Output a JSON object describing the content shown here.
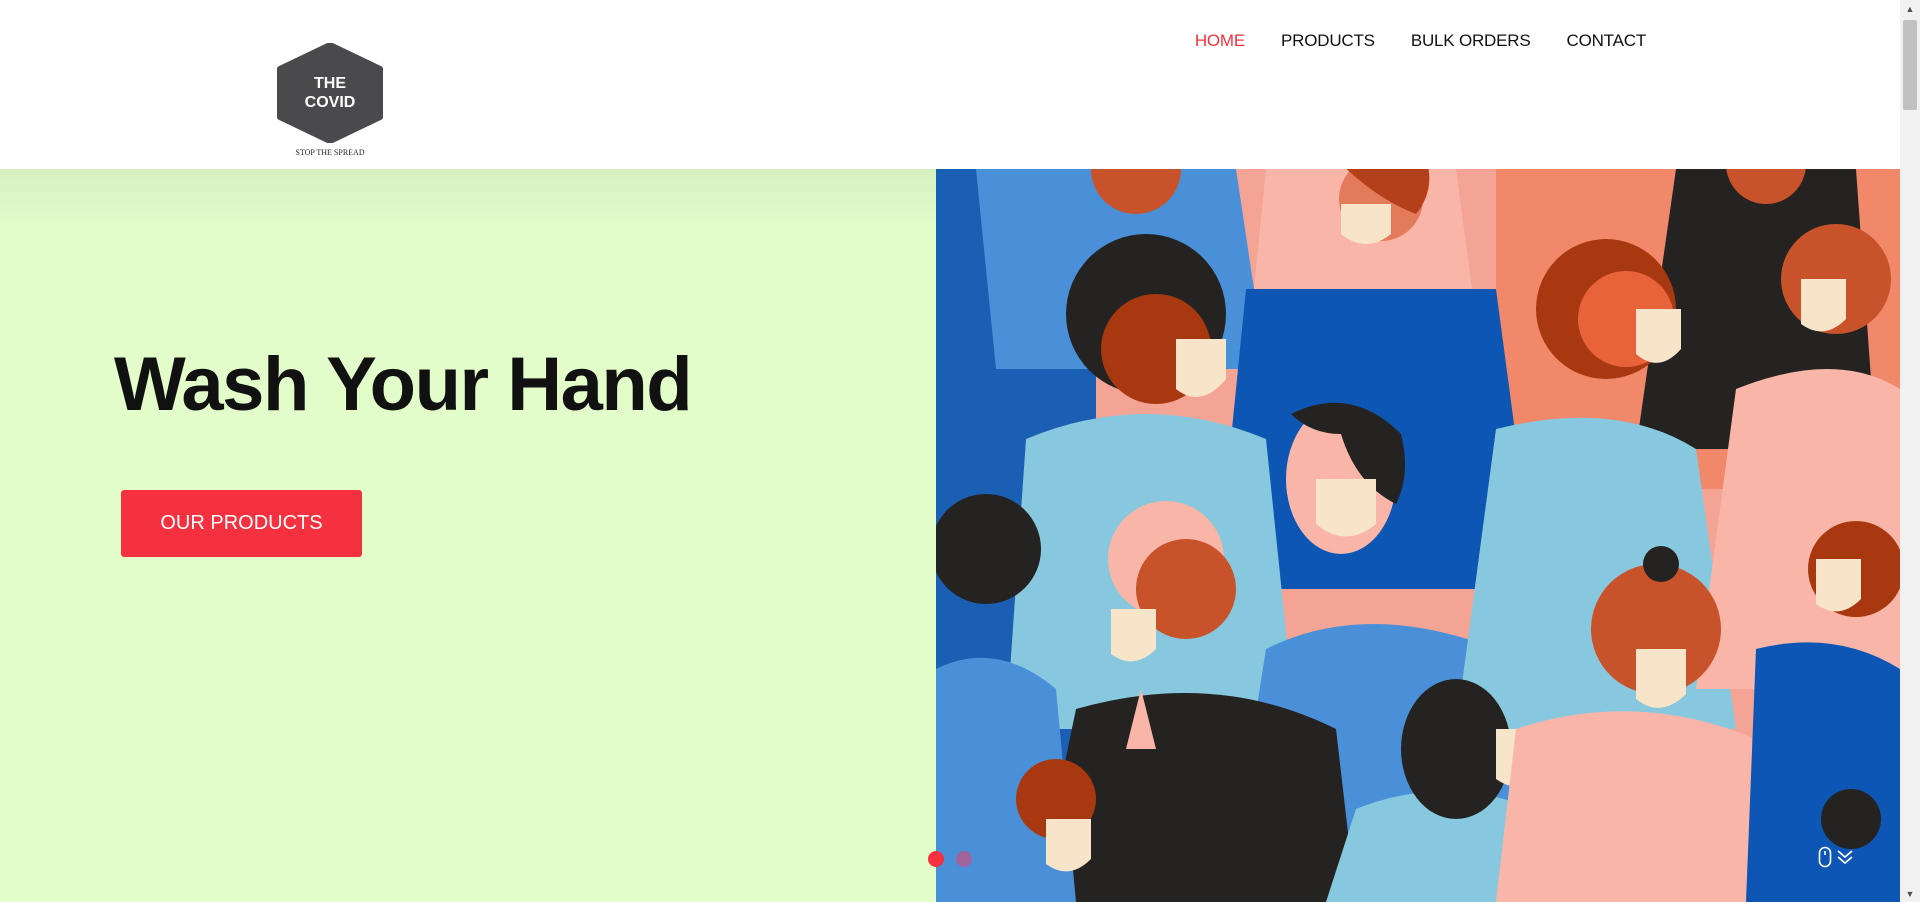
{
  "brand": {
    "logo_line1": "THE",
    "logo_line2": "COVID",
    "tagline": "STOP THE SPREAD",
    "logo_color": "#4a4a4c"
  },
  "nav": {
    "items": [
      {
        "label": "HOME",
        "active": true
      },
      {
        "label": "PRODUCTS",
        "active": false
      },
      {
        "label": "BULK ORDERS",
        "active": false
      },
      {
        "label": "CONTACT",
        "active": false
      }
    ],
    "active_color": "#f0323f"
  },
  "hero": {
    "title": "Wash Your Hand",
    "cta_label": "OUR PRODUCTS",
    "left_bg": "#e2fdca",
    "accent": "#f5313f",
    "illustration": "crowd-wearing-masks-illustration",
    "slides": [
      {
        "active": true
      },
      {
        "active": false
      }
    ]
  },
  "icons": {
    "scroll": "mouse-icon",
    "scroll_arrow": "chevron-double-down-icon"
  }
}
